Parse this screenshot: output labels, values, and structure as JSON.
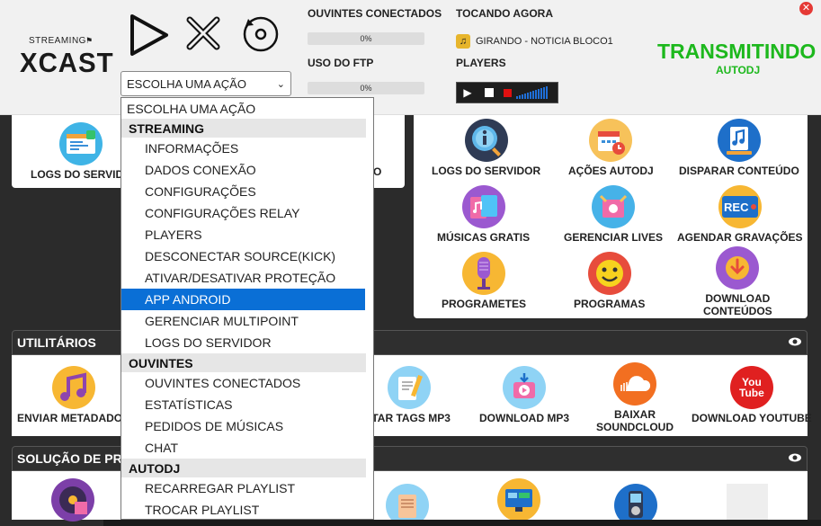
{
  "header": {
    "logo_top": "STREAMING",
    "logo_main": "XCAST",
    "action_select_value": "ESCOLHA UMA AÇÃO",
    "listeners_label": "OUVINTES CONECTADOS",
    "listeners_progress_text": "0%",
    "listeners_progress": 0,
    "ftp_label": "USO DO FTP",
    "ftp_progress_text": "0%",
    "ftp_progress": 0,
    "now_playing_label": "TOCANDO AGORA",
    "now_playing_track": "GIRANDO - NOTICIA BLOCO1",
    "players_label": "PLAYERS",
    "status_main": "TRANSMITINDO",
    "status_sub": "AUTODJ",
    "status_color": "#1db81d"
  },
  "top_left_panel": {
    "tile_logs": "LOGS DO SERVIDO",
    "tile_right_fragment": "O"
  },
  "top_right_panel": {
    "tiles": [
      {
        "label": "LOGS DO SERVIDOR",
        "icon": "info-icon"
      },
      {
        "label": "AÇÕES AUTODJ",
        "icon": "calendar-icon"
      },
      {
        "label": "DISPARAR CONTEÚDO",
        "icon": "music-file-icon"
      },
      {
        "label": "MÚSICAS GRATIS",
        "icon": "music-folder-icon"
      },
      {
        "label": "GERENCIAR LIVES",
        "icon": "live-icon"
      },
      {
        "label": "AGENDAR GRAVAÇÕES",
        "icon": "rec-icon",
        "icon_text": "REC"
      },
      {
        "label": "PROGRAMETES",
        "icon": "microphone-icon"
      },
      {
        "label": "PROGRAMAS",
        "icon": "smiley-icon"
      },
      {
        "label": "DOWNLOAD CONTEÚDOS",
        "line1": "DOWNLOAD",
        "line2": "CONTEÚDOS",
        "icon": "download-icon"
      }
    ]
  },
  "utilitarios": {
    "title": "UTILITÁRIOS",
    "tiles": [
      {
        "label": "ENVIAR METADADOS",
        "icon": "music-notes-icon"
      },
      {
        "label": "ITAR TAGS MP3",
        "icon": "tags-icon"
      },
      {
        "label": "DOWNLOAD MP3",
        "icon": "download-mp3-icon"
      },
      {
        "label": "BAIXAR SOUNDCLOUD",
        "line1": "BAIXAR",
        "line2": "SOUNDCLOUD",
        "icon": "soundcloud-icon"
      },
      {
        "label": "DOWNLOAD YOUTUBE",
        "icon": "youtube-icon",
        "icon_text": "You Tube"
      }
    ]
  },
  "solucao": {
    "title": "SOLUÇÃO DE PRO"
  },
  "dropdown": {
    "first": "ESCOLHA UMA AÇÃO",
    "groups": [
      {
        "name": "STREAMING",
        "items": [
          "INFORMAÇÕES",
          "DADOS CONEXÃO",
          "CONFIGURAÇÕES",
          "CONFIGURAÇÕES RELAY",
          "PLAYERS",
          "DESCONECTAR SOURCE(KICK)",
          "ATIVAR/DESATIVAR PROTEÇÃO",
          "APP ANDROID",
          "GERENCIAR MULTIPOINT",
          "LOGS DO SERVIDOR"
        ]
      },
      {
        "name": "OUVINTES",
        "items": [
          "OUVINTES CONECTADOS",
          "ESTATÍSTICAS",
          "PEDIDOS DE MÚSICAS",
          "CHAT"
        ]
      },
      {
        "name": "AUTODJ",
        "items": [
          "RECARREGAR PLAYLIST",
          "TROCAR PLAYLIST"
        ]
      }
    ],
    "selected": "APP ANDROID",
    "selected_color": "#0a6fd6"
  }
}
